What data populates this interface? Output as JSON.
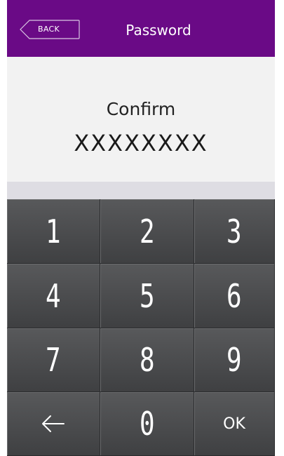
{
  "header": {
    "back_label": "BACK",
    "title": "Password",
    "background_color": "#6a0a86"
  },
  "prompt": {
    "label": "Confirm",
    "value": "XXXXXXXX"
  },
  "keypad": {
    "keys": [
      "1",
      "2",
      "3",
      "4",
      "5",
      "6",
      "7",
      "8",
      "9",
      "",
      "0",
      "OK"
    ],
    "backspace_icon": "left-arrow-icon"
  }
}
